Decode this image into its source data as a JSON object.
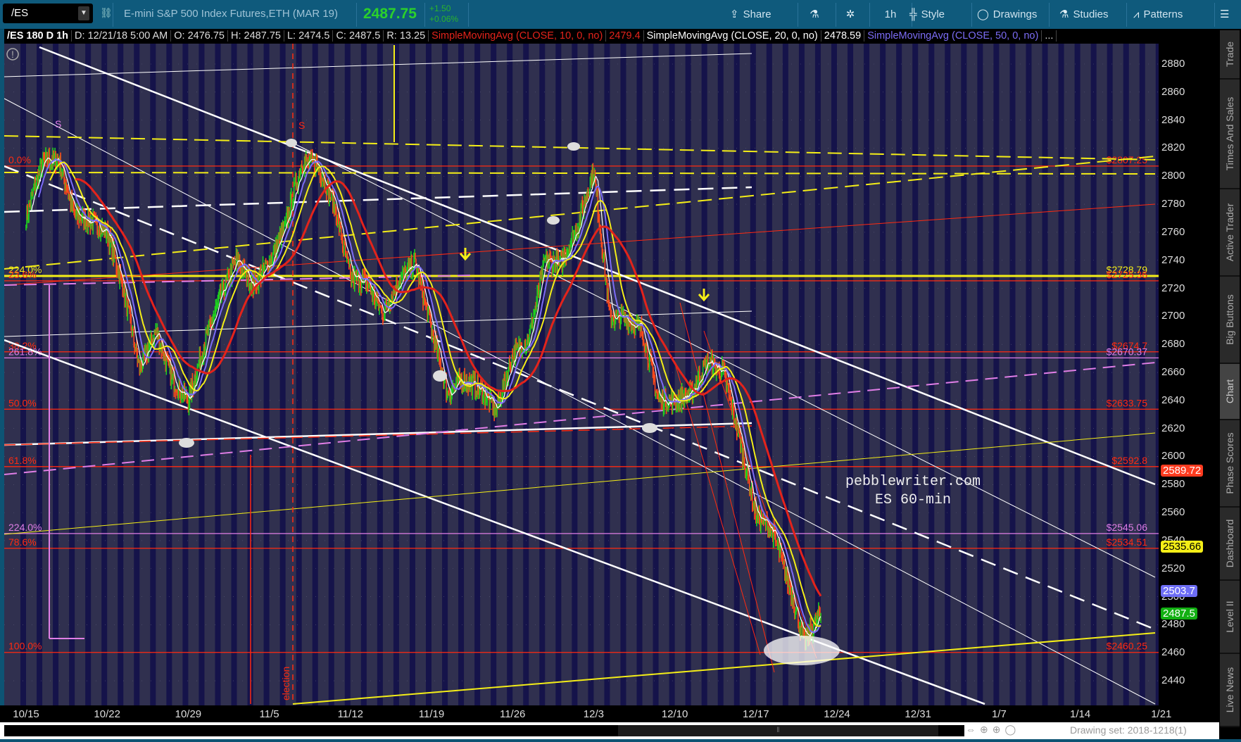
{
  "header": {
    "symbol": "/ES",
    "description": "E-mini S&P 500 Index Futures,ETH (MAR 19)",
    "last_price": "2487.75",
    "net_change": "+1.50",
    "pct_change": "+0.06%",
    "toolbar": {
      "share": "Share",
      "timeframe": "1h",
      "style": "Style",
      "drawings": "Drawings",
      "studies": "Studies",
      "patterns": "Patterns"
    }
  },
  "legend": {
    "title": "/ES 180 D 1h",
    "date": "D: 12/21/18 5:00 AM",
    "open": "O: 2476.75",
    "high": "H: 2487.75",
    "low": "L: 2474.5",
    "close": "C: 2487.5",
    "range": "R: 13.25",
    "sma10_name": "SimpleMovingAvg (CLOSE, 10, 0, no)",
    "sma10_value": "2479.4",
    "sma20_name": "SimpleMovingAvg (CLOSE, 20, 0, no)",
    "sma20_value": "2478.59",
    "sma50_name": "SimpleMovingAvg (CLOSE, 50, 0, no)",
    "more": "..."
  },
  "colors": {
    "sma10": "#e3231b",
    "sma20": "#ffffff",
    "sma50": "#7b6cf5",
    "up": "#1fcf1f",
    "down": "#ff4a1a",
    "fib": "#ff2a10",
    "violet": "#e07ee6",
    "yellow": "#f4ee17"
  },
  "chart_data": {
    "type": "candlestick",
    "title": "/ES 180 D 1h",
    "ylim": [
      2425,
      2900
    ],
    "y_ticks": [
      "2880",
      "2860",
      "2840",
      "2820",
      "2800",
      "2780",
      "2760",
      "2740",
      "2720",
      "2700",
      "2680",
      "2660",
      "2640",
      "2620",
      "2600",
      "2580",
      "2560",
      "2540",
      "2520",
      "2500",
      "2480",
      "2460",
      "2440"
    ],
    "x_ticks": [
      "10/15",
      "10/22",
      "10/29",
      "11/5",
      "11/12",
      "11/19",
      "11/26",
      "12/3",
      "12/10",
      "12/17",
      "12/24",
      "12/31",
      "1/7",
      "1/14",
      "1/21"
    ],
    "price_points": [
      [
        "10/15",
        2770
      ],
      [
        "10/16",
        2810
      ],
      [
        "10/17",
        2812
      ],
      [
        "10/18",
        2772
      ],
      [
        "10/19",
        2768
      ],
      [
        "10/22",
        2760
      ],
      [
        "10/23",
        2720
      ],
      [
        "10/24",
        2662
      ],
      [
        "10/25",
        2690
      ],
      [
        "10/26",
        2655
      ],
      [
        "10/29",
        2640
      ],
      [
        "10/30",
        2680
      ],
      [
        "10/31",
        2715
      ],
      [
        "11/1",
        2740
      ],
      [
        "11/2",
        2722
      ],
      [
        "11/5",
        2738
      ],
      [
        "11/6",
        2765
      ],
      [
        "11/7",
        2810
      ],
      [
        "11/8",
        2808
      ],
      [
        "11/9",
        2780
      ],
      [
        "11/12",
        2728
      ],
      [
        "11/13",
        2724
      ],
      [
        "11/14",
        2702
      ],
      [
        "11/15",
        2726
      ],
      [
        "11/16",
        2738
      ],
      [
        "11/19",
        2690
      ],
      [
        "11/20",
        2645
      ],
      [
        "11/21",
        2655
      ],
      [
        "11/22",
        2648
      ],
      [
        "11/23",
        2633
      ],
      [
        "11/26",
        2672
      ],
      [
        "11/27",
        2684
      ],
      [
        "11/28",
        2740
      ],
      [
        "11/29",
        2738
      ],
      [
        "11/30",
        2765
      ],
      [
        "12/3",
        2805
      ],
      [
        "12/4",
        2700
      ],
      [
        "12/5",
        2698
      ],
      [
        "12/6",
        2690
      ],
      [
        "12/7",
        2640
      ],
      [
        "12/10",
        2640
      ],
      [
        "12/11",
        2645
      ],
      [
        "12/12",
        2668
      ],
      [
        "12/13",
        2660
      ],
      [
        "12/14",
        2612
      ],
      [
        "12/17",
        2558
      ],
      [
        "12/18",
        2548
      ],
      [
        "12/19",
        2510
      ],
      [
        "12/20",
        2468
      ],
      [
        "12/21",
        2487.5
      ]
    ],
    "fib_levels": [
      {
        "left": "0.0%",
        "right": "$2807.25",
        "price": 2807.25,
        "color": "#ff2a10"
      },
      {
        "left": "224.0%",
        "right": "$2728.79",
        "price": 2728.79,
        "color": "#f4ee17"
      },
      {
        "left": "23.6%",
        "right": "$2725.36",
        "price": 2725.36,
        "color": "#ff2a10"
      },
      {
        "left": "38.2%",
        "right": "$2674.7",
        "price": 2674.7,
        "color": "#ff2a10"
      },
      {
        "left": "261.8%",
        "right": "$2670.37",
        "price": 2670.37,
        "color": "#e07ee6"
      },
      {
        "left": "50.0%",
        "right": "$2633.75",
        "price": 2633.75,
        "color": "#ff2a10"
      },
      {
        "left": "61.8%",
        "right": "$2592.8",
        "price": 2592.8,
        "color": "#ff2a10"
      },
      {
        "left": "224.0%",
        "right": "$2545.06",
        "price": 2545.06,
        "color": "#e07ee6"
      },
      {
        "left": "78.6%",
        "right": "$2534.51",
        "price": 2534.51,
        "color": "#ff2a10"
      },
      {
        "left": "100.0%",
        "right": "$2460.25",
        "price": 2460.25,
        "color": "#ff2a10"
      }
    ],
    "price_tags": [
      {
        "label": "2589.72",
        "price": 2589.72,
        "bg": "#ff3b1f",
        "fg": "#ffffff"
      },
      {
        "label": "2535.66",
        "price": 2535.66,
        "bg": "#f4ee17",
        "fg": "#000000"
      },
      {
        "label": "2503.7",
        "price": 2503.7,
        "bg": "#6d6df5",
        "fg": "#ffffff"
      },
      {
        "label": "2487.5",
        "price": 2487.5,
        "bg": "#12b012",
        "fg": "#ffffff"
      }
    ],
    "annotations": {
      "watermark_line1": "pebblewriter.com",
      "watermark_line2": "ES 60-min",
      "event": "election",
      "swing_mark_1": "S",
      "swing_mark_2": "S"
    }
  },
  "footer": {
    "drawing_set": "Drawing set: 2018-1218(1)"
  },
  "side_tabs": [
    "Trade",
    "Times And Sales",
    "Active Trader",
    "Big Buttons",
    "Chart",
    "Phase Scores",
    "Dashboard",
    "Level II",
    "Live News"
  ]
}
